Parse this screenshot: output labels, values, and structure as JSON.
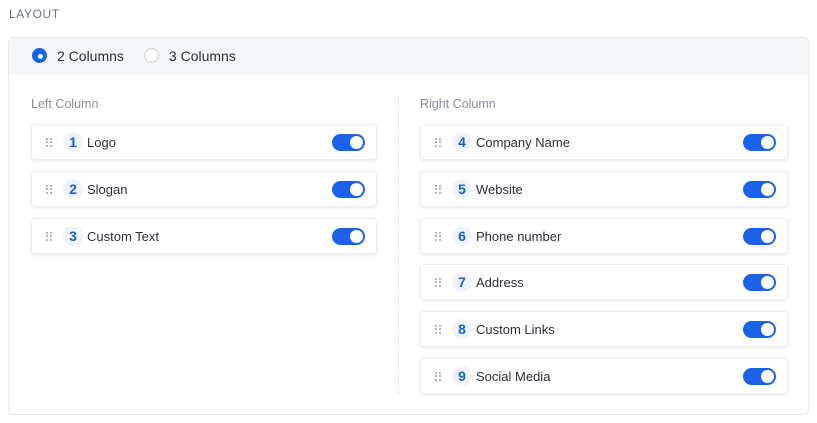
{
  "section": {
    "title": "LAYOUT"
  },
  "layout_options": [
    {
      "label": "2 Columns",
      "selected": true
    },
    {
      "label": "3 Columns",
      "selected": false
    }
  ],
  "left_column": {
    "label": "Left Column",
    "items": [
      {
        "number": "1",
        "label": "Logo",
        "enabled": true
      },
      {
        "number": "2",
        "label": "Slogan",
        "enabled": true
      },
      {
        "number": "3",
        "label": "Custom Text",
        "enabled": true
      }
    ]
  },
  "right_column": {
    "label": "Right Column",
    "items": [
      {
        "number": "4",
        "label": "Company Name",
        "enabled": true
      },
      {
        "number": "5",
        "label": "Website",
        "enabled": true
      },
      {
        "number": "6",
        "label": "Phone number",
        "enabled": true
      },
      {
        "number": "7",
        "label": "Address",
        "enabled": true
      },
      {
        "number": "8",
        "label": "Custom Links",
        "enabled": true
      },
      {
        "number": "9",
        "label": "Social Media",
        "enabled": true
      }
    ]
  },
  "colors": {
    "accent": "#1a63e8",
    "badge_bg": "#eef3fd"
  }
}
